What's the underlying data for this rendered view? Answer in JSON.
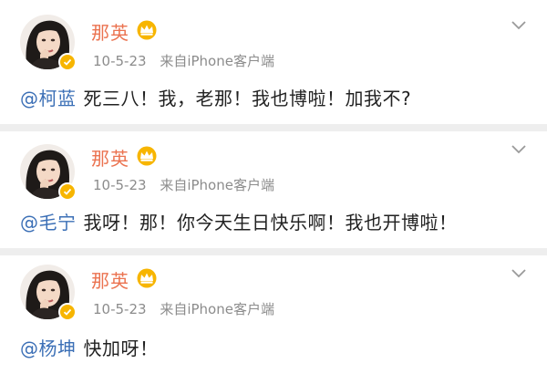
{
  "posts": [
    {
      "username": "那英",
      "date": "10-5-23",
      "source": "来自iPhone客户端",
      "mention": "@柯蓝",
      "text": "死三八！我，老那！我也博啦！加我不?"
    },
    {
      "username": "那英",
      "date": "10-5-23",
      "source": "来自iPhone客户端",
      "mention": "@毛宁",
      "text": "我呀！那！你今天生日快乐啊！我也开博啦！"
    },
    {
      "username": "那英",
      "date": "10-5-23",
      "source": "来自iPhone客户端",
      "mention": "@杨坤",
      "text": "快加呀！"
    }
  ],
  "icons": {
    "crown": "crown-icon",
    "verified": "verified-badge-icon",
    "chevron": "chevron-down-icon"
  },
  "colors": {
    "username": "#eb7350",
    "mention": "#3b6fb6",
    "meta": "#8c8c8c",
    "crown": "#f7b500"
  }
}
